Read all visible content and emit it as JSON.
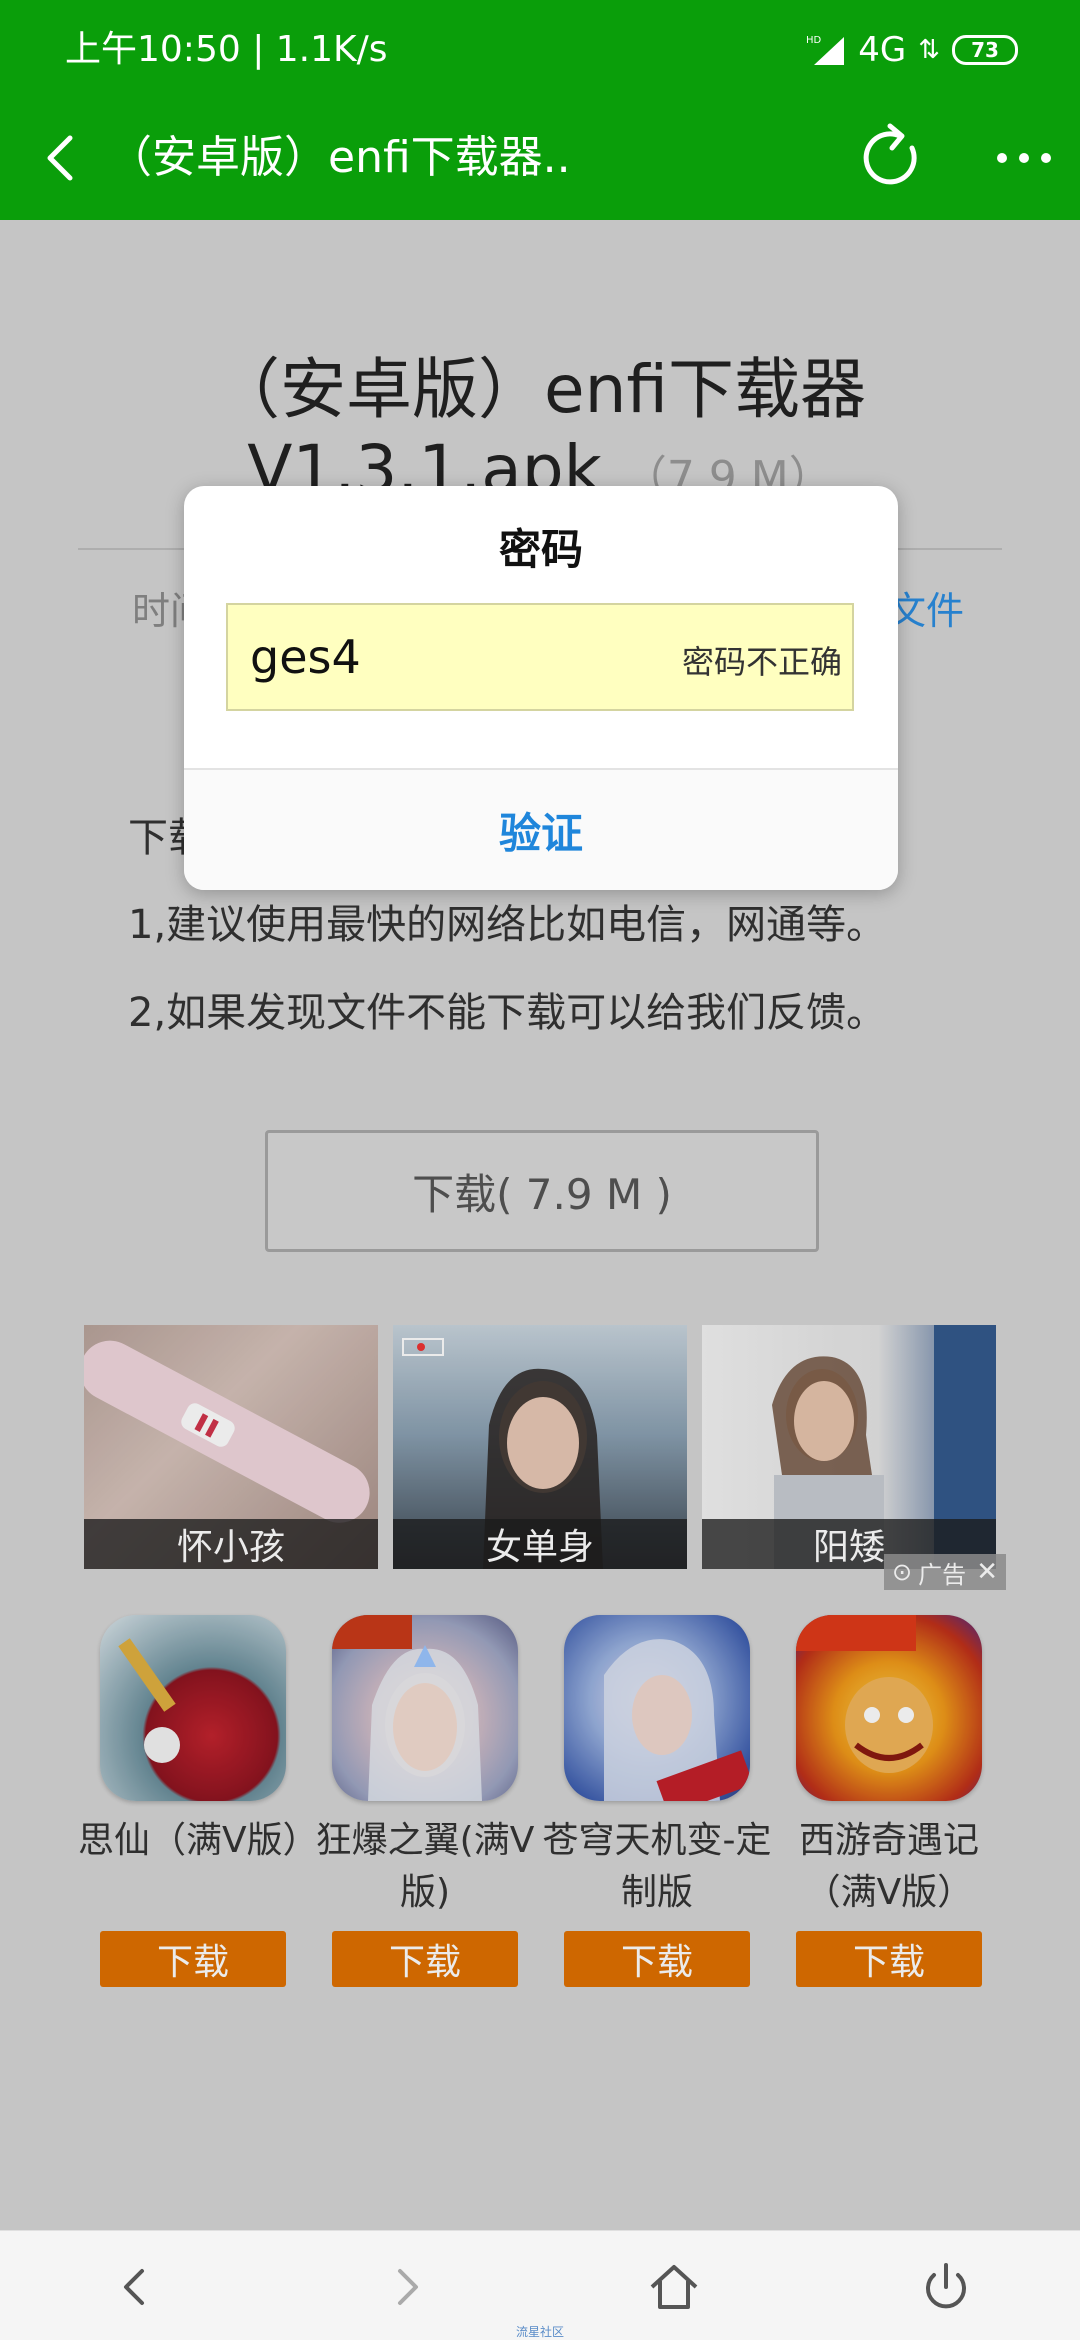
{
  "status_bar": {
    "time_speed": "上午10:50 | 1.1K/s",
    "network": "4G",
    "hd_label": "HD",
    "battery": "73"
  },
  "title_bar": {
    "title": "（安卓版）enfi下载器..",
    "icons": [
      "back-icon",
      "refresh-icon",
      "more-icon"
    ]
  },
  "file": {
    "title": "（安卓版）enfi下载器V1.3.1.apk",
    "size": "（7.9 M）",
    "meta_left": "时间",
    "meta_right": "文件"
  },
  "notes": {
    "heading": "下载",
    "line1": "1,建议使用最快的网络比如电信，网通等。",
    "line2": "2,如果发现文件不能下载可以给我们反馈。"
  },
  "download_button": "下载( 7.9 M )",
  "ads": {
    "tiles": [
      {
        "caption": "怀小孩"
      },
      {
        "caption": "女单身"
      },
      {
        "caption": "阳矮"
      }
    ],
    "badge": "广告",
    "close": "✕"
  },
  "apps": [
    {
      "name": "思仙（满V版）",
      "download": "下载"
    },
    {
      "name": "狂爆之翼(满V版)",
      "download": "下载"
    },
    {
      "name": "苍穹天机变-定制版",
      "download": "下载"
    },
    {
      "name": "西游奇遇记（满V版）",
      "download": "下载"
    }
  ],
  "dialog": {
    "title": "密码",
    "password_value": "ges4",
    "error": "密码不正确",
    "verify": "验证"
  },
  "navbar": {
    "icons": [
      "nav-back-icon",
      "nav-forward-icon",
      "home-icon",
      "power-icon"
    ],
    "credit": "流星社区"
  },
  "colors": {
    "header_green": "#0a9e0a",
    "link_blue": "#1f86db",
    "app_download_orange": "#e07000",
    "field_yellow": "#ffffc0"
  }
}
